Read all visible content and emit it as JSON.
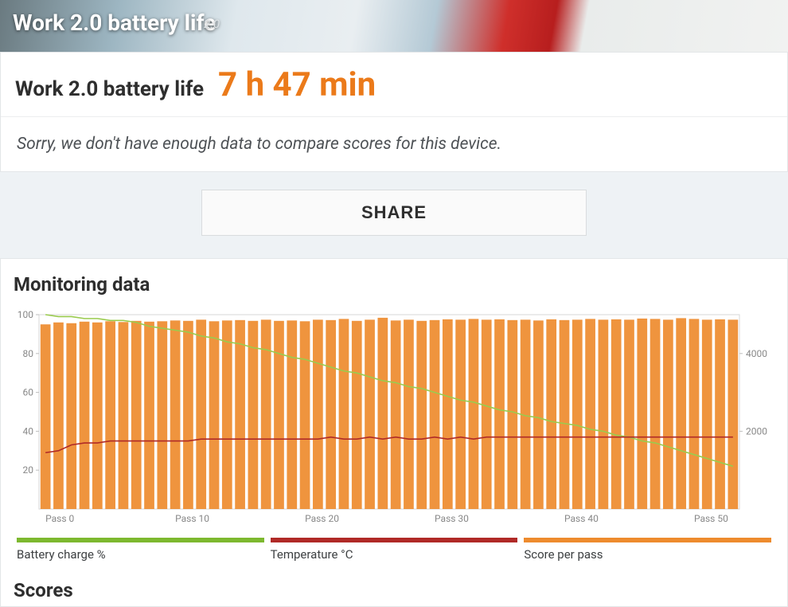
{
  "hero": {
    "title": "Work 2.0 battery life",
    "version": "2.0"
  },
  "score": {
    "label": "Work 2.0 battery life",
    "value": "7 h 47 min"
  },
  "compare_message": "Sorry, we don't have enough data to compare scores for this device.",
  "share_label": "SHARE",
  "monitoring_title": "Monitoring data",
  "legend": {
    "battery": "Battery charge %",
    "temperature": "Temperature °C",
    "score": "Score per pass"
  },
  "scores_title": "Scores",
  "chart_data": {
    "type": "bar",
    "title": "Monitoring data",
    "xlabel": "Pass",
    "x_tick_prefix": "Pass ",
    "left_axis": {
      "label": "",
      "range": [
        0,
        100
      ],
      "ticks": [
        20,
        40,
        60,
        80,
        100
      ]
    },
    "right_axis": {
      "label": "",
      "range": [
        0,
        5000
      ],
      "ticks": [
        2000,
        4000
      ]
    },
    "passes": 54,
    "series": [
      {
        "name": "Score per pass",
        "axis": "right",
        "color": "#ee8b2e",
        "render": "bar",
        "values": [
          4750,
          4800,
          4780,
          4820,
          4800,
          4830,
          4810,
          4840,
          4820,
          4830,
          4850,
          4840,
          4870,
          4830,
          4850,
          4860,
          4840,
          4870,
          4840,
          4850,
          4830,
          4870,
          4860,
          4890,
          4840,
          4870,
          4920,
          4850,
          4870,
          4840,
          4860,
          4880,
          4870,
          4890,
          4870,
          4880,
          4860,
          4870,
          4850,
          4880,
          4860,
          4870,
          4890,
          4870,
          4880,
          4870,
          4900,
          4890,
          4870,
          4910,
          4890,
          4870,
          4880,
          4870
        ]
      },
      {
        "name": "Battery charge %",
        "axis": "left",
        "color": "#9acb4e",
        "render": "line",
        "values": [
          100,
          99,
          99,
          98,
          98,
          97,
          97,
          96,
          94,
          93,
          92,
          91,
          89,
          88,
          86,
          85,
          83,
          82,
          80,
          78,
          77,
          75,
          73,
          71,
          70,
          68,
          66,
          65,
          63,
          62,
          60,
          58,
          56,
          55,
          53,
          51,
          50,
          48,
          47,
          45,
          44,
          43,
          41,
          40,
          38,
          37,
          35,
          34,
          32,
          30,
          28,
          26,
          24,
          22
        ]
      },
      {
        "name": "Temperature °C",
        "axis": "left",
        "color": "#b02a27",
        "render": "line",
        "values": [
          29,
          30,
          33,
          34,
          34,
          35,
          35,
          35,
          35,
          35,
          35,
          35,
          36,
          36,
          36,
          36,
          36,
          36,
          36,
          36,
          36,
          36,
          37,
          36,
          36,
          37,
          36,
          37,
          36,
          36,
          37,
          36,
          37,
          36,
          37,
          37,
          37,
          37,
          37,
          37,
          37,
          37,
          37,
          37,
          37,
          37,
          37,
          37,
          37,
          37,
          37,
          37,
          37,
          37
        ]
      }
    ]
  }
}
